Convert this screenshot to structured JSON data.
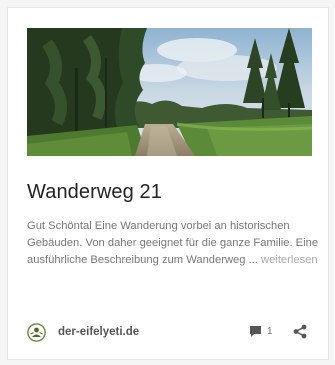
{
  "card": {
    "image_alt": "Waldweg mit Bäumen unter bewölktem Himmel",
    "title": "Wanderweg 21",
    "excerpt": "Gut Schöntal Eine Wanderung vorbei an historischen Gebäuden. Von daher geeignet für die ganze Familie. Eine ausführliche Beschreibung zum Wanderweg ...",
    "read_more": "weiterlesen",
    "source": {
      "name": "der-eifelyeti.de",
      "logo_icon": "yeti-logo-icon"
    },
    "comments": {
      "icon": "comment-icon",
      "count": "1"
    },
    "share_icon": "share-icon"
  },
  "colors": {
    "title": "#222222",
    "excerpt": "#777777",
    "read_more": "#a9a9a9",
    "icons": "#555555",
    "page_background": "#f5f5f5",
    "card_background": "#ffffff"
  }
}
